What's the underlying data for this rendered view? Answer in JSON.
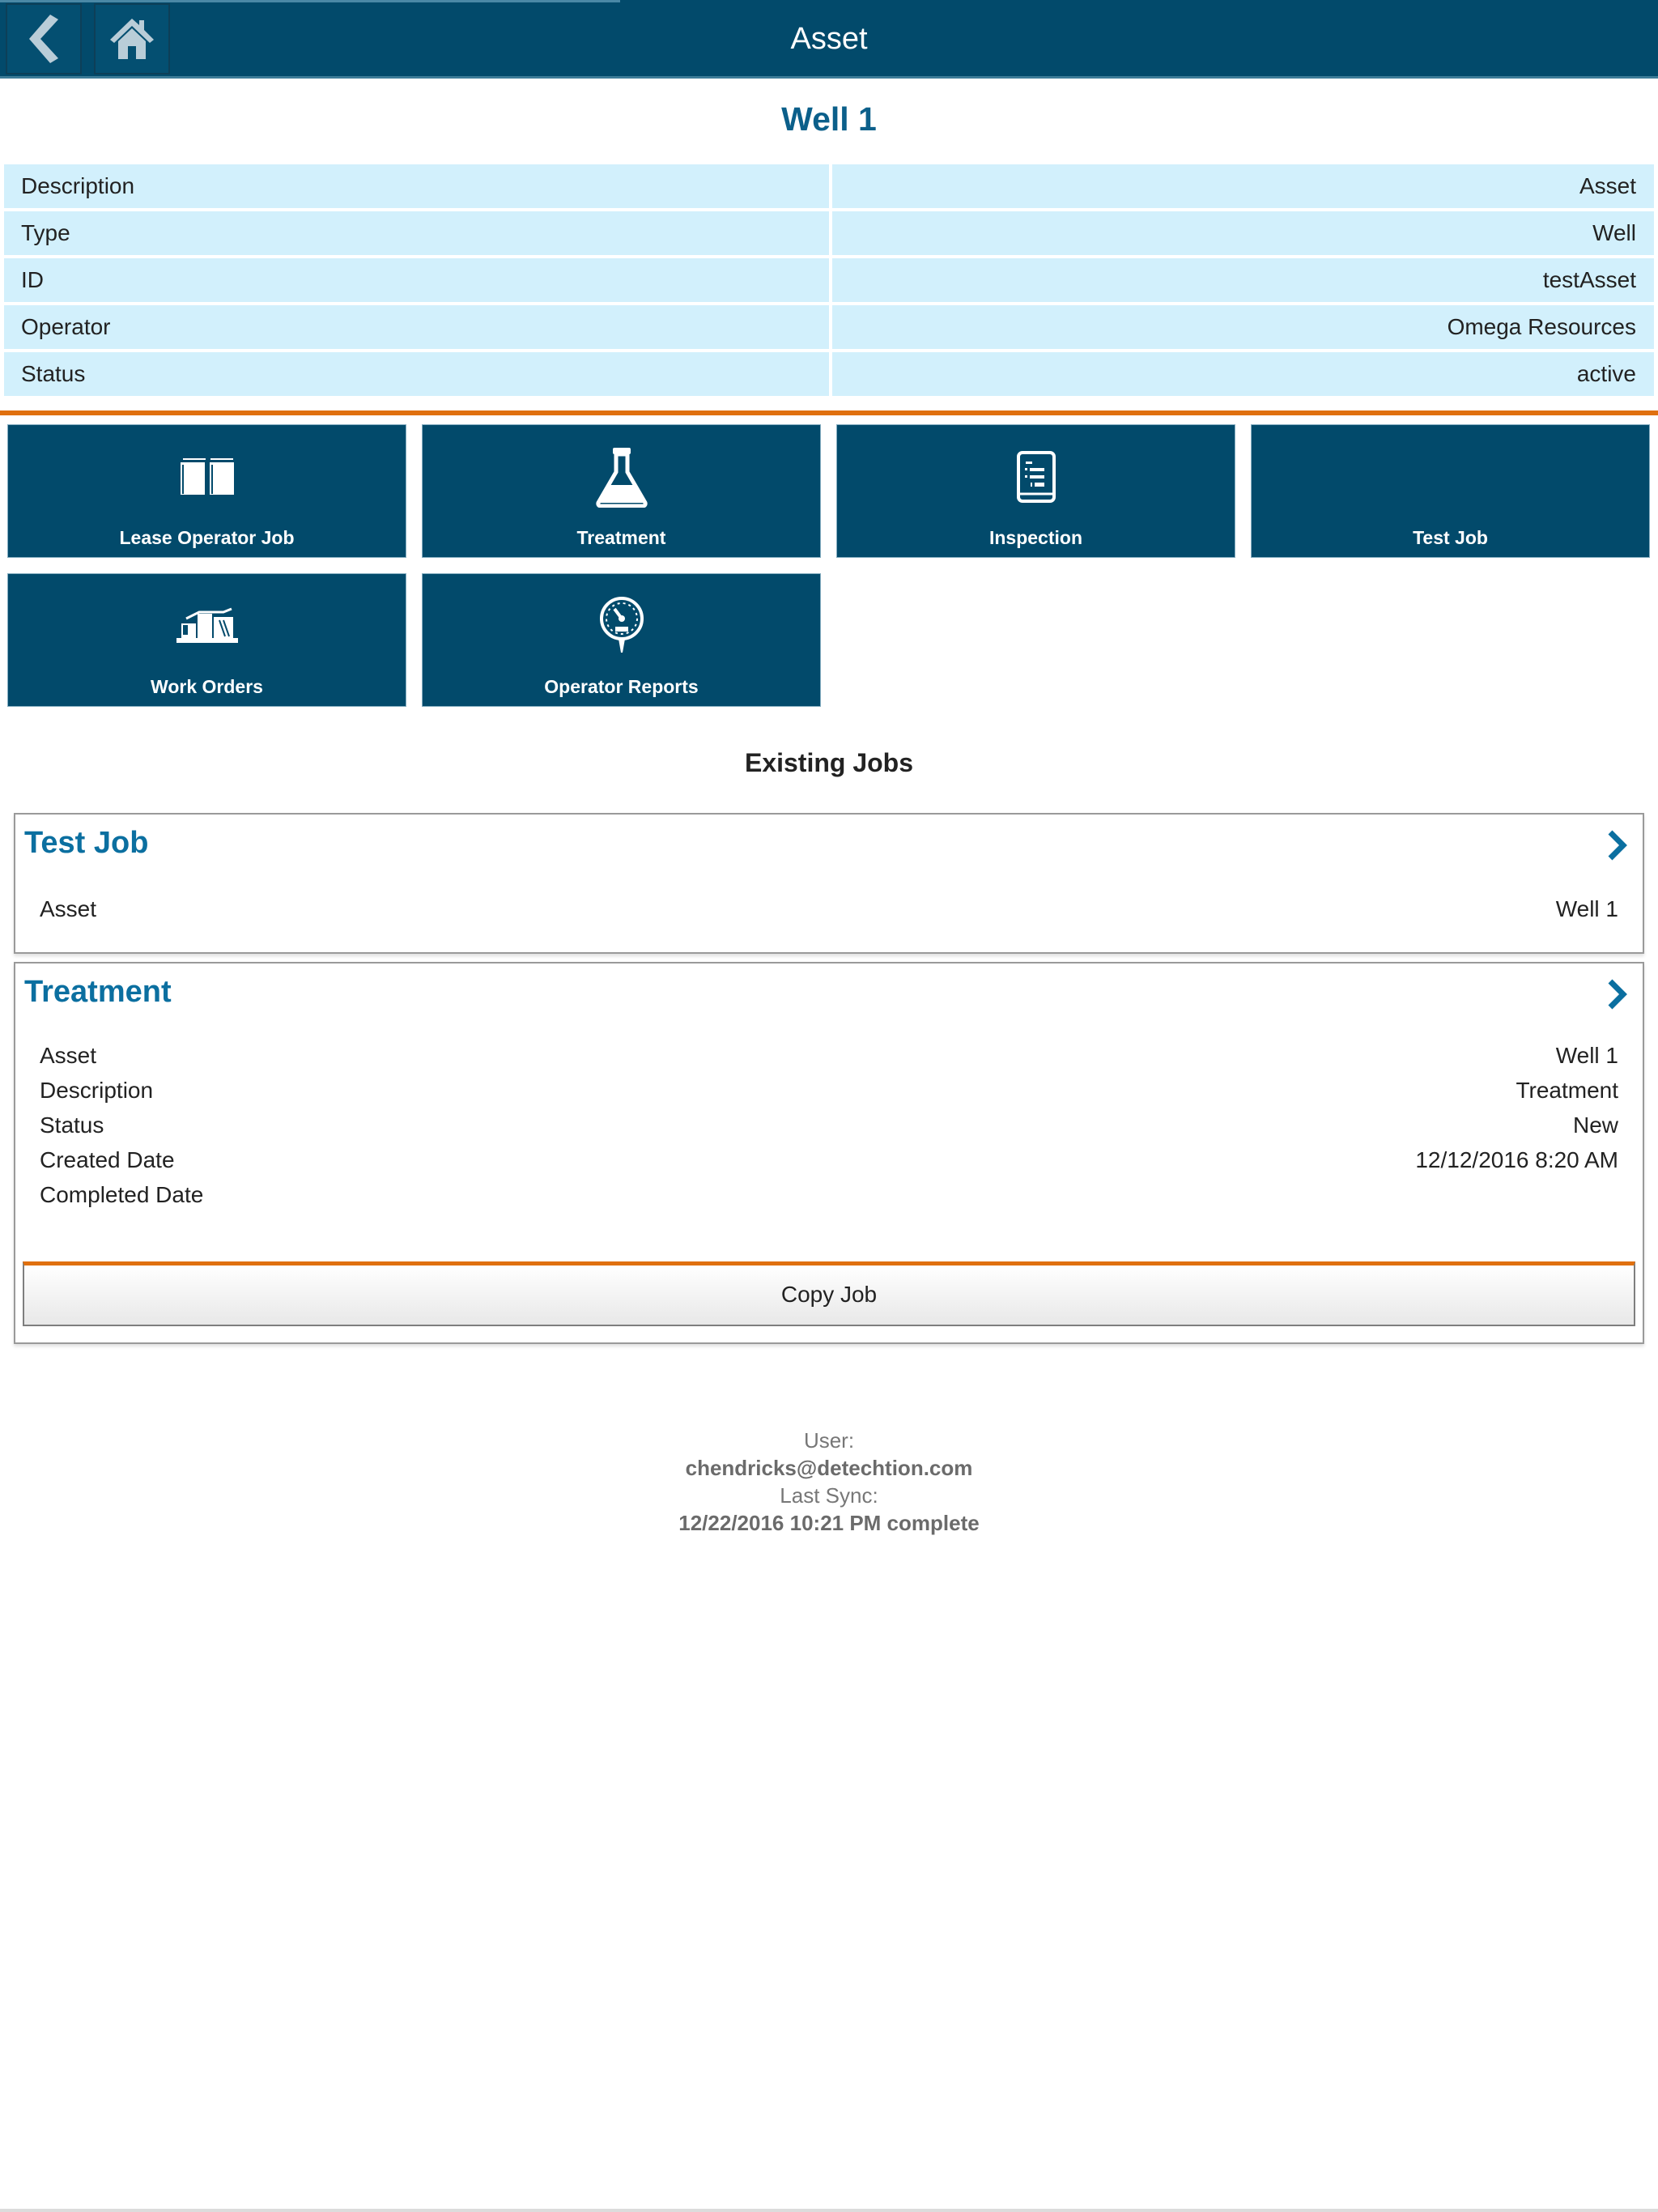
{
  "header": {
    "title": "Asset",
    "back_icon": "chevron-left-icon",
    "home_icon": "home-icon"
  },
  "asset": {
    "title": "Well 1",
    "fields": [
      {
        "label": "Description",
        "value": "Asset"
      },
      {
        "label": "Type",
        "value": "Well"
      },
      {
        "label": "ID",
        "value": "testAsset"
      },
      {
        "label": "Operator",
        "value": "Omega Resources"
      },
      {
        "label": "Status",
        "value": "active"
      }
    ]
  },
  "tiles": [
    {
      "label": "Lease Operator Job",
      "icon": "books-icon"
    },
    {
      "label": "Treatment",
      "icon": "flask-icon"
    },
    {
      "label": "Inspection",
      "icon": "checklist-tablet-icon"
    },
    {
      "label": "Test Job",
      "icon": ""
    },
    {
      "label": "Work Orders",
      "icon": "pump-jack-icon"
    },
    {
      "label": "Operator Reports",
      "icon": "pressure-gauge-icon"
    }
  ],
  "existing_jobs": {
    "title": "Existing Jobs",
    "jobs": [
      {
        "title": "Test Job",
        "fields": [
          {
            "label": "Asset",
            "value": "Well 1"
          }
        ]
      },
      {
        "title": "Treatment",
        "fields": [
          {
            "label": "Asset",
            "value": "Well 1"
          },
          {
            "label": "Description",
            "value": "Treatment"
          },
          {
            "label": "Status",
            "value": "New"
          },
          {
            "label": "Created Date",
            "value": "12/12/2016 8:20 AM"
          },
          {
            "label": "Completed Date",
            "value": ""
          }
        ],
        "action_label": "Copy Job"
      }
    ]
  },
  "footer": {
    "user_label": "User:",
    "user_value": "chendricks@detechtion.com",
    "sync_label": "Last Sync:",
    "sync_value": "12/22/2016 10:21 PM complete"
  },
  "colors": {
    "header_bg": "#024a6b",
    "accent_orange": "#e0700f",
    "title_blue": "#0b5f8a",
    "info_row_bg": "#d2f0fc"
  }
}
